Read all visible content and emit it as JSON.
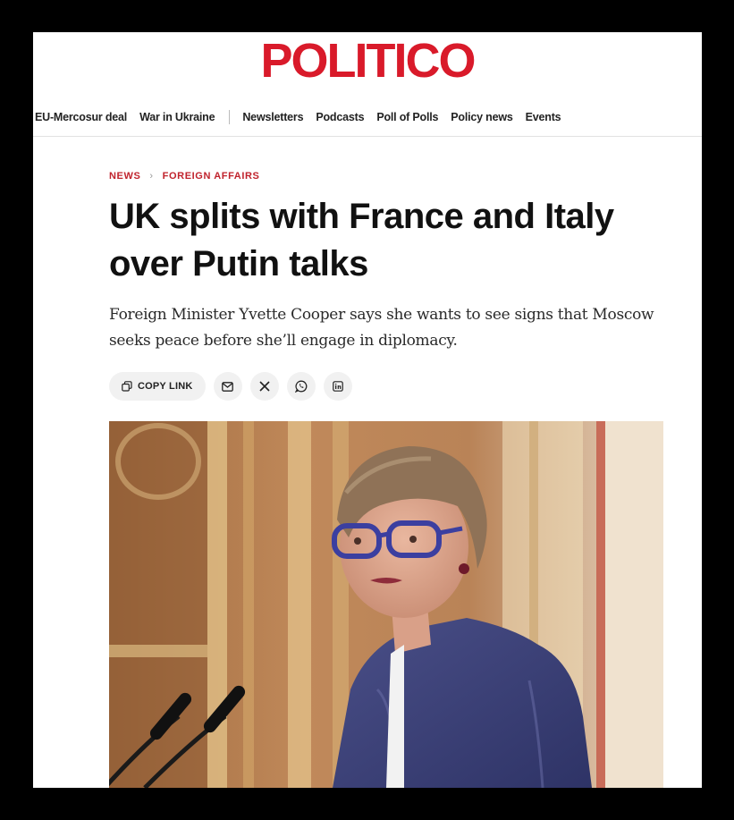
{
  "brand": {
    "logo": "POLITICO",
    "color": "#d91a2a"
  },
  "nav": {
    "items": [
      {
        "label": "EU-Mercosur deal"
      },
      {
        "label": "War in Ukraine"
      },
      {
        "label": "Newsletters"
      },
      {
        "label": "Podcasts"
      },
      {
        "label": "Poll of Polls"
      },
      {
        "label": "Policy news"
      },
      {
        "label": "Events"
      }
    ]
  },
  "breadcrumb": {
    "section": "NEWS",
    "subsection": "FOREIGN AFFAIRS"
  },
  "article": {
    "headline": "UK splits with France and Italy over Putin talks",
    "dek": "Foreign Minister Yvette Cooper says she wants to see signs that Moscow seeks peace before she’ll engage in diplomacy."
  },
  "share": {
    "copy_link": "COPY LINK",
    "icons": [
      "mail-icon",
      "x-icon",
      "whatsapp-icon",
      "linkedin-icon"
    ]
  },
  "photo": {
    "subject": "photo"
  }
}
